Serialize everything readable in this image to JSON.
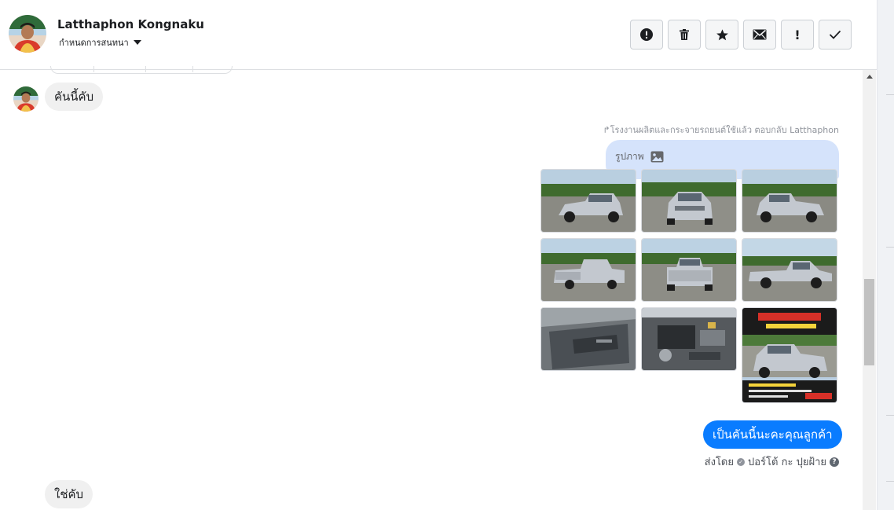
{
  "header": {
    "user_name": "Latthaphon Kongnaku",
    "assign_label": "กำหนดการสนทนา",
    "toolbar": [
      {
        "name": "report-spam-button",
        "icon": "alert-circle-icon"
      },
      {
        "name": "delete-button",
        "icon": "trash-icon"
      },
      {
        "name": "star-button",
        "icon": "star-icon"
      },
      {
        "name": "mark-unread-button",
        "icon": "envelope-icon"
      },
      {
        "name": "flag-important-button",
        "icon": "exclamation-icon",
        "label": "!"
      },
      {
        "name": "mark-done-button",
        "icon": "check-icon"
      }
    ]
  },
  "messages": {
    "incoming_1": "คันนี้คับ",
    "reply_note": "โรงงานผลิตและกระจายรถยนต์ใช้แล้ว ตอบกลับ Latthaphon",
    "reply_quote": "รูปภาพ",
    "outgoing_1": "เป็นคันนี้นะคะคุณลูกค้า",
    "sent_by_prefix": "ส่งโดย",
    "sent_by_name": "ปอร์โต้ กะ ปุยฝ้าย",
    "help_glyph": "?",
    "incoming_2": "ใช่คับ"
  },
  "photos": [
    {
      "name": "truck-front-left-photo",
      "view": "front-left"
    },
    {
      "name": "truck-front-photo",
      "view": "front"
    },
    {
      "name": "truck-front-right-photo",
      "view": "front-right"
    },
    {
      "name": "truck-rear-left-photo",
      "view": "rear-left"
    },
    {
      "name": "truck-rear-photo",
      "view": "rear"
    },
    {
      "name": "truck-side-photo",
      "view": "side"
    },
    {
      "name": "truck-door-interior-photo",
      "view": "door"
    },
    {
      "name": "truck-engine-photo",
      "view": "engine"
    },
    {
      "name": "truck-ad-poster-photo",
      "view": "ad"
    }
  ],
  "colors": {
    "outgoing_bubble": "#0a7cff",
    "incoming_bubble": "#f0f0f0",
    "reply_quote": "#d5e3fb"
  }
}
